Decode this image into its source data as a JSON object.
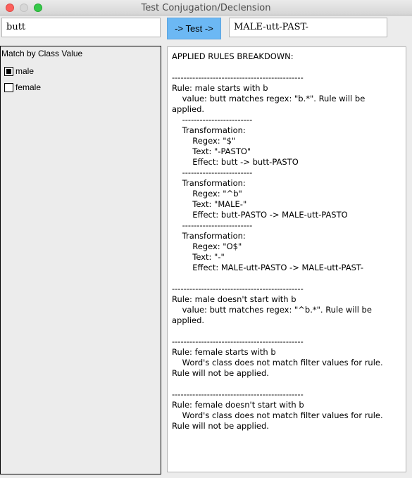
{
  "window": {
    "title": "Test Conjugation/Declension"
  },
  "word_input": {
    "value": "butt"
  },
  "test_button": {
    "label": "-> Test ->"
  },
  "result_input": {
    "value": "MALE-utt-PAST-"
  },
  "class_filter": {
    "heading": "Match by Class Value",
    "options": [
      {
        "label": "male",
        "checked": true
      },
      {
        "label": "female",
        "checked": false
      }
    ]
  },
  "breakdown": {
    "text": "APPLIED RULES BREAKDOWN:\n\n---------------------------------------------\nRule: male starts with b\n    value: butt matches regex: \"b.*\". Rule will be\napplied.\n    ------------------------\n    Transformation:\n        Regex: \"$\"\n        Text: \"-PASTO\"\n        Effect: butt -> butt-PASTO\n    ------------------------\n    Transformation:\n        Regex: \"^b\"\n        Text: \"MALE-\"\n        Effect: butt-PASTO -> MALE-utt-PASTO\n    ------------------------\n    Transformation:\n        Regex: \"O$\"\n        Text: \"-\"\n        Effect: MALE-utt-PASTO -> MALE-utt-PAST-\n\n---------------------------------------------\nRule: male doesn't start with b\n    value: butt matches regex: \"^b.*\". Rule will be\napplied.\n\n---------------------------------------------\nRule: female starts with b\n    Word's class does not match filter values for rule.\nRule will not be applied.\n\n---------------------------------------------\nRule: female doesn't start with b\n    Word's class does not match filter values for rule.\nRule will not be applied."
  }
}
